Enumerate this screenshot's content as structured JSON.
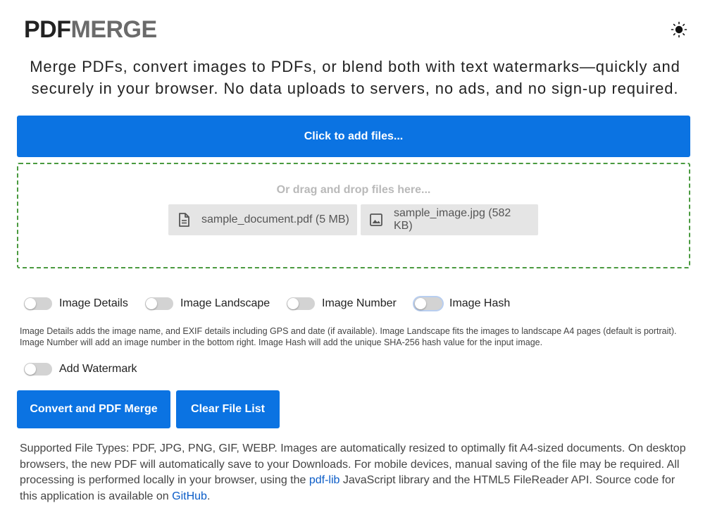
{
  "header": {
    "logo_part1": "PDF",
    "logo_part2": "MERGE",
    "theme_icon": "sun-icon"
  },
  "tagline": "Merge PDFs, convert images to PDFs, or blend both with text watermarks—quickly and securely in your browser. No data uploads to servers, no ads, and no sign-up required.",
  "upload": {
    "add_files_label": "Click to add files...",
    "drop_hint": "Or drag and drop files here...",
    "files": [
      {
        "name": "sample_document.pdf (5 MB)",
        "icon": "document-icon"
      },
      {
        "name": "sample_image.jpg (582 KB)",
        "icon": "image-icon"
      }
    ]
  },
  "options": {
    "toggles": [
      {
        "label": "Image Details",
        "checked": false
      },
      {
        "label": "Image Landscape",
        "checked": false
      },
      {
        "label": "Image Number",
        "checked": false
      },
      {
        "label": "Image Hash",
        "checked": false
      }
    ],
    "description": "Image Details adds the image name, and EXIF details including GPS and date (if available). Image Landscape fits the images to landscape A4 pages (default is portrait). Image Number will add an image number in the bottom right. Image Hash will add the unique SHA-256 hash value for the input image.",
    "watermark_label": "Add Watermark",
    "watermark_checked": false
  },
  "actions": {
    "merge_label": "Convert and PDF Merge",
    "clear_label": "Clear File List"
  },
  "footer": {
    "text_1": "Supported File Types: PDF, JPG, PNG, GIF, WEBP. Images are automatically resized to optimally fit A4-sized documents. On desktop browsers, the new PDF will automatically save to your Downloads. For mobile devices, manual saving of the file may be required. All processing is performed locally in your browser, using the ",
    "link_1": "pdf-lib",
    "text_2": " JavaScript library and the HTML5 FileReader API. Source code for this application is available on ",
    "link_2": "GitHub",
    "text_3": "."
  },
  "colors": {
    "primary": "#0b73e2",
    "dropzone_border": "#4a9a3f",
    "chip_bg": "#e5e5e5",
    "link": "#0b5cc7"
  }
}
